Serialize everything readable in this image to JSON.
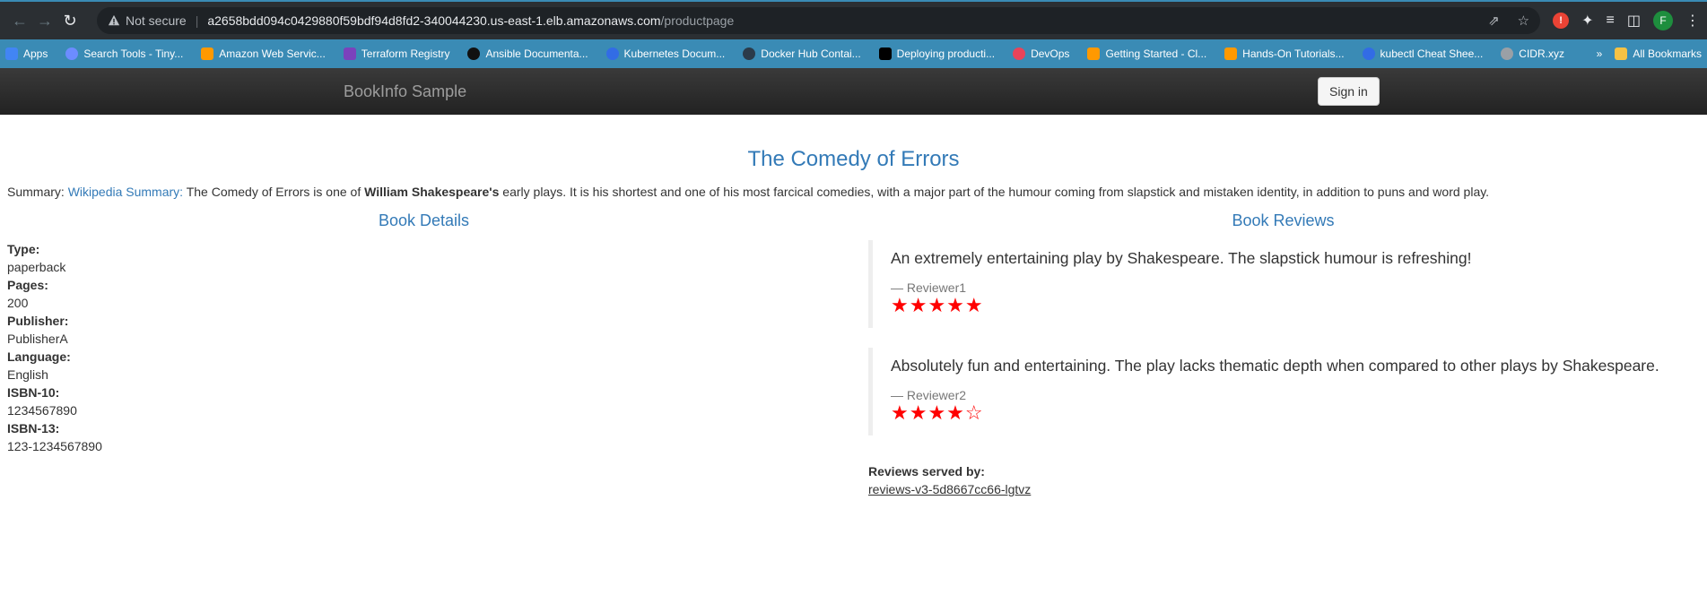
{
  "browser": {
    "security_label": "Not secure",
    "url_host": "a2658bdd094c0429880f59bdf94d8fd2-340044230.us-east-1.elb.amazonaws.com",
    "url_path": "/productpage",
    "profile_initial": "F",
    "bookmarks": [
      {
        "label": "Apps",
        "color": "#4285f4"
      },
      {
        "label": "Search Tools - Tiny...",
        "color": "#6c8cff"
      },
      {
        "label": "Amazon Web Servic...",
        "color": "#ff9900"
      },
      {
        "label": "Terraform Registry",
        "color": "#7b42bc"
      },
      {
        "label": "Ansible Documenta...",
        "color": "#111111"
      },
      {
        "label": "Kubernetes Docum...",
        "color": "#326ce5"
      },
      {
        "label": "Docker Hub Contai...",
        "color": "#2b3b4a"
      },
      {
        "label": "Deploying producti...",
        "color": "#000000"
      },
      {
        "label": "DevOps",
        "color": "#e8445a"
      },
      {
        "label": "Getting Started - Cl...",
        "color": "#ff9900"
      },
      {
        "label": "Hands-On Tutorials...",
        "color": "#ff9900"
      },
      {
        "label": "kubectl Cheat Shee...",
        "color": "#326ce5"
      },
      {
        "label": "CIDR.xyz",
        "color": "#9aa0a6"
      }
    ],
    "more_bookmarks": "»",
    "all_bookmarks": "All Bookmarks"
  },
  "app": {
    "brand": "BookInfo Sample",
    "signin_label": "Sign in"
  },
  "product": {
    "title": "The Comedy of Errors",
    "summary_prefix": "Summary: ",
    "summary_link": "Wikipedia Summary:",
    "summary_text1": " The Comedy of Errors is one of ",
    "summary_bold": "William Shakespeare's",
    "summary_text2": " early plays. It is his shortest and one of his most farcical comedies, with a major part of the humour coming from slapstick and mistaken identity, in addition to puns and word play."
  },
  "details": {
    "heading": "Book Details",
    "type_label": "Type:",
    "type": "paperback",
    "pages_label": "Pages:",
    "pages": "200",
    "publisher_label": "Publisher:",
    "publisher": "PublisherA",
    "language_label": "Language:",
    "language": "English",
    "isbn10_label": "ISBN-10:",
    "isbn10": "1234567890",
    "isbn13_label": "ISBN-13:",
    "isbn13": "123-1234567890"
  },
  "reviews": {
    "heading": "Book Reviews",
    "items": [
      {
        "text": "An extremely entertaining play by Shakespeare. The slapstick humour is refreshing!",
        "reviewer": "— Reviewer1",
        "rating": 5,
        "stars": "★★★★★"
      },
      {
        "text": "Absolutely fun and entertaining. The play lacks thematic depth when compared to other plays by Shakespeare.",
        "reviewer": "— Reviewer2",
        "rating": 4,
        "stars": "★★★★☆"
      }
    ],
    "served_label": "Reviews served by:",
    "served_by": "reviews-v3-5d8667cc66-lgtvz",
    "star_color": "#ff0000"
  }
}
